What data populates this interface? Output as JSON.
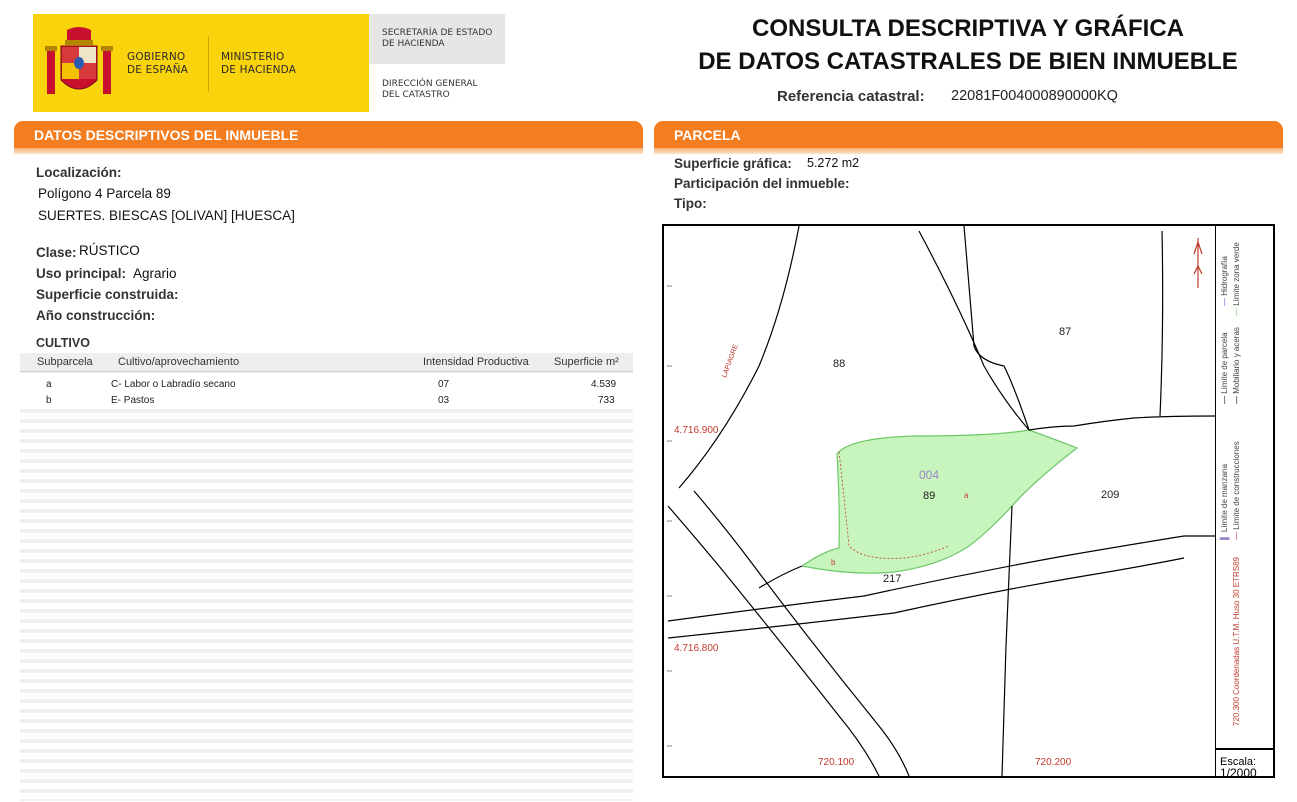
{
  "header": {
    "gobierno": [
      "GOBIERNO",
      "DE ESPAÑA"
    ],
    "ministerio": [
      "MINISTERIO",
      "DE HACIENDA"
    ],
    "secretaria": [
      "SECRETARÍA DE ESTADO",
      "DE HACIENDA"
    ],
    "direccion": [
      "DIRECCIÓN GENERAL",
      "DEL CATASTRO"
    ],
    "title_line1": "CONSULTA DESCRIPTIVA Y GRÁFICA",
    "title_line2": "DE DATOS CATASTRALES DE BIEN INMUEBLE",
    "ref_label": "Referencia catastral:",
    "ref_value": "22081F004000890000KQ",
    "colors": {
      "brand_yellow": "#f9d30b",
      "section_orange": "#f47d1f",
      "shield_red": "#c8102e"
    }
  },
  "descriptivos": {
    "section_title": "DATOS DESCRIPTIVOS DEL INMUEBLE",
    "localizacion_label": "Localización:",
    "localizacion_line1": "Polígono 4 Parcela 89",
    "localizacion_line2": "SUERTES. BIESCAS [OLIVAN] [HUESCA]",
    "clase_label": "Clase:",
    "clase_value": "RÚSTICO",
    "uso_label": "Uso principal:",
    "uso_value": "Agrario",
    "sup_construida_label": "Superficie construida:",
    "anio_label": "Año construcción:"
  },
  "cultivo": {
    "title": "CULTIVO",
    "headers": [
      "Subparcela",
      "Cultivo/aprovechamiento",
      "Intensidad Productiva",
      "Superficie m²"
    ],
    "rows": [
      [
        "a",
        "C- Labor o Labradío secano",
        "07",
        "4.539"
      ],
      [
        "b",
        "E- Pastos",
        "03",
        "733"
      ]
    ]
  },
  "parcela": {
    "section_title": "PARCELA",
    "superficie_label": "Superficie gráfica:",
    "superficie_value": "5.272 m2",
    "participacion_label": "Participación del inmueble:",
    "tipo_label": "Tipo:"
  },
  "map": {
    "labels": {
      "p88": "88",
      "p87": "87",
      "p89": "89",
      "p209": "209",
      "p217": "217",
      "sub004": "004",
      "sub_a": "a",
      "sub_b": "b",
      "y_upper": "4.716.900",
      "y_lower": "4.716.800",
      "x_left": "720.100",
      "x_right": "720.200",
      "road": "LAPIAGRE"
    },
    "legend": {
      "hidrografia": "Hidrografía",
      "zona_verde": "Límite zona verde",
      "parcela": "Límite de parcela",
      "mobiliario": "Mobiliario y aceras",
      "manzana": "Límite de manzana",
      "construcciones": "Límite de construcciones",
      "coords": "720.300 Coordenadas U.T.M. Huso 30 ETRS89"
    },
    "scale_label": "Escala:",
    "scale_value": "1/2000",
    "colors": {
      "parcel_fill": "#c8f5bd",
      "parcel_edge": "#6fc86a",
      "red_labels": "#c0392b",
      "subparcel_label": "#9b87c6"
    }
  }
}
